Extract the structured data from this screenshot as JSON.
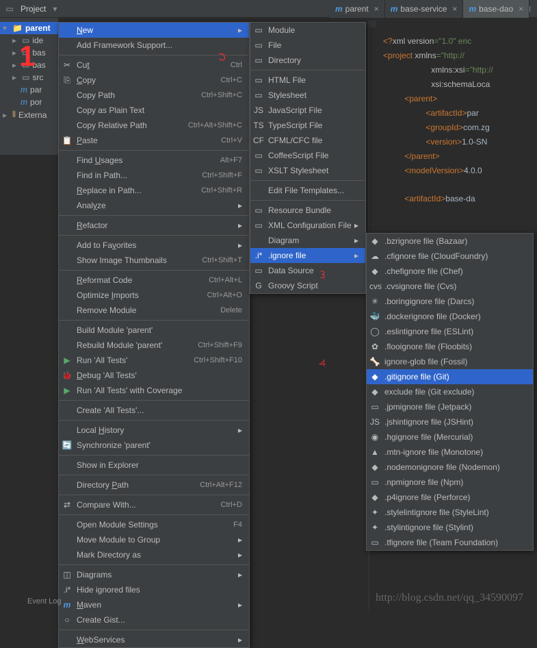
{
  "toolbar": {
    "title": "Project"
  },
  "tabs": [
    {
      "label": "parent"
    },
    {
      "label": "base-service"
    },
    {
      "label": "base-dao"
    }
  ],
  "tree": {
    "root": "parent",
    "items": [
      "ide",
      "bas",
      "bas",
      "src",
      "par",
      "por"
    ],
    "external": "Externa"
  },
  "menu1": [
    {
      "t": "New",
      "sel": true,
      "arr": true,
      "u": 0
    },
    {
      "t": "Add Framework Support..."
    },
    {
      "sep": true
    },
    {
      "t": "Cut",
      "sc": "Ctrl",
      "ico": "✂",
      "u": 2
    },
    {
      "t": "Copy",
      "sc": "Ctrl+C",
      "ico": "⎘",
      "u": 0
    },
    {
      "t": "Copy Path",
      "sc": "Ctrl+Shift+C"
    },
    {
      "t": "Copy as Plain Text"
    },
    {
      "t": "Copy Relative Path",
      "sc": "Ctrl+Alt+Shift+C"
    },
    {
      "t": "Paste",
      "sc": "Ctrl+V",
      "ico": "📋",
      "u": 0
    },
    {
      "sep": true
    },
    {
      "t": "Find Usages",
      "sc": "Alt+F7",
      "u": 5
    },
    {
      "t": "Find in Path...",
      "sc": "Ctrl+Shift+F"
    },
    {
      "t": "Replace in Path...",
      "sc": "Ctrl+Shift+R",
      "u": 0
    },
    {
      "t": "Analyze",
      "arr": true,
      "u": 4
    },
    {
      "sep": true
    },
    {
      "t": "Refactor",
      "arr": true,
      "u": 0
    },
    {
      "sep": true
    },
    {
      "t": "Add to Favorites",
      "arr": true,
      "u": 9
    },
    {
      "t": "Show Image Thumbnails",
      "sc": "Ctrl+Shift+T"
    },
    {
      "sep": true
    },
    {
      "t": "Reformat Code",
      "sc": "Ctrl+Alt+L",
      "u": 0
    },
    {
      "t": "Optimize Imports",
      "sc": "Ctrl+Alt+O",
      "u": 9
    },
    {
      "t": "Remove Module",
      "sc": "Delete"
    },
    {
      "sep": true
    },
    {
      "t": "Build Module 'parent'"
    },
    {
      "t": "Rebuild Module 'parent'",
      "sc": "Ctrl+Shift+F9"
    },
    {
      "t": "Run 'All Tests'",
      "sc": "Ctrl+Shift+F10",
      "ico": "▶"
    },
    {
      "t": "Debug 'All Tests'",
      "ico": "🐞",
      "u": 0
    },
    {
      "t": "Run 'All Tests' with Coverage",
      "ico": "▶"
    },
    {
      "sep": true
    },
    {
      "t": "Create 'All Tests'..."
    },
    {
      "sep": true
    },
    {
      "t": "Local History",
      "arr": true,
      "u": 6
    },
    {
      "t": "Synchronize 'parent'",
      "ico": "🔄"
    },
    {
      "sep": true
    },
    {
      "t": "Show in Explorer"
    },
    {
      "sep": true
    },
    {
      "t": "Directory Path",
      "sc": "Ctrl+Alt+F12",
      "u": 10
    },
    {
      "sep": true
    },
    {
      "t": "Compare With...",
      "sc": "Ctrl+D",
      "ico": "⇄"
    },
    {
      "sep": true
    },
    {
      "t": "Open Module Settings",
      "sc": "F4"
    },
    {
      "t": "Move Module to Group",
      "arr": true
    },
    {
      "t": "Mark Directory as",
      "arr": true
    },
    {
      "sep": true
    },
    {
      "t": "Diagrams",
      "arr": true,
      "ico": "◫",
      "u": 3
    },
    {
      "t": "Hide ignored files",
      "ico": ".i*"
    },
    {
      "t": "Maven",
      "arr": true,
      "ico": "m",
      "u": 0
    },
    {
      "t": "Create Gist...",
      "ico": "○"
    },
    {
      "sep": true
    },
    {
      "t": "WebServices",
      "arr": true,
      "u": 0
    }
  ],
  "menu2": [
    {
      "t": "Module",
      "ico": "▭"
    },
    {
      "t": "File",
      "ico": "▭"
    },
    {
      "t": "Directory",
      "ico": "▭"
    },
    {
      "sep": true
    },
    {
      "t": "HTML File",
      "ico": "▭"
    },
    {
      "t": "Stylesheet",
      "ico": "▭"
    },
    {
      "t": "JavaScript File",
      "ico": "JS"
    },
    {
      "t": "TypeScript File",
      "ico": "TS"
    },
    {
      "t": "CFML/CFC file",
      "ico": "CF"
    },
    {
      "t": "CoffeeScript File",
      "ico": "▭"
    },
    {
      "t": "XSLT Stylesheet",
      "ico": "▭"
    },
    {
      "sep": true
    },
    {
      "t": "Edit File Templates..."
    },
    {
      "sep": true
    },
    {
      "t": "Resource Bundle",
      "ico": "▭"
    },
    {
      "t": "XML Configuration File",
      "arr": true,
      "ico": "▭"
    },
    {
      "t": "Diagram",
      "arr": true
    },
    {
      "t": ".ignore file",
      "arr": true,
      "sel": true,
      "ico": ".i*"
    },
    {
      "t": "Data Source",
      "ico": "▭"
    },
    {
      "t": "Groovy Script",
      "ico": "G"
    }
  ],
  "menu3": [
    {
      "t": ".bzrignore file (Bazaar)",
      "ico": "◆"
    },
    {
      "t": ".cfignore file (CloudFoundry)",
      "ico": "☁"
    },
    {
      "t": ".chefignore file (Chef)",
      "ico": "◆"
    },
    {
      "t": ".cvsignore file (Cvs)",
      "ico": "cvs"
    },
    {
      "t": ".boringignore file (Darcs)",
      "ico": "✳"
    },
    {
      "t": ".dockerignore file (Docker)",
      "ico": "🐳"
    },
    {
      "t": ".eslintignore file (ESLint)",
      "ico": "◯"
    },
    {
      "t": ".flooignore file (Floobits)",
      "ico": "✿"
    },
    {
      "t": "ignore-glob file (Fossil)",
      "ico": "🦴"
    },
    {
      "t": ".gitignore file (Git)",
      "ico": "◆",
      "sel": true
    },
    {
      "t": "exclude file (Git exclude)",
      "ico": "◆"
    },
    {
      "t": ".jpmignore file (Jetpack)",
      "ico": "▭"
    },
    {
      "t": ".jshintignore file (JSHint)",
      "ico": "JS"
    },
    {
      "t": ".hgignore file (Mercurial)",
      "ico": "◉"
    },
    {
      "t": ".mtn-ignore file (Monotone)",
      "ico": "▲"
    },
    {
      "t": ".nodemonignore file (Nodemon)",
      "ico": "◆"
    },
    {
      "t": ".npmignore file (Npm)",
      "ico": "▭"
    },
    {
      "t": ".p4ignore file (Perforce)",
      "ico": "◆"
    },
    {
      "t": ".stylelintignore file (StyleLint)",
      "ico": "✦"
    },
    {
      "t": ".stylintignore file (Stylint)",
      "ico": "✦"
    },
    {
      "t": ".tfignore file (Team Foundation)",
      "ico": "▭"
    }
  ],
  "editor": {
    "l1a": "<?",
    "l1b": "xml version",
    "l1c": "=\"1.0\" enc",
    "l2a": "<",
    "l2b": "project ",
    "l2c": "xmlns",
    "l2d": "=\"http://",
    "l3a": "xmlns:xsi",
    "l3b": "=\"http://",
    "l4a": "xsi:schemaLoca",
    "l5": "<parent>",
    "l6a": "<artifactId>",
    "l6b": "par",
    "l7a": "<groupId>",
    "l7b": "com.zg",
    "l8a": "<version>",
    "l8b": "1.0-SN",
    "l9": "</parent>",
    "l10a": "<modelVersion>",
    "l10b": "4.0.0",
    "l11a": "<artifactId>",
    "l11b": "base-da"
  },
  "eventlog": "Event Log",
  "watermark": "http://blog.csdn.net/qq_34590097"
}
